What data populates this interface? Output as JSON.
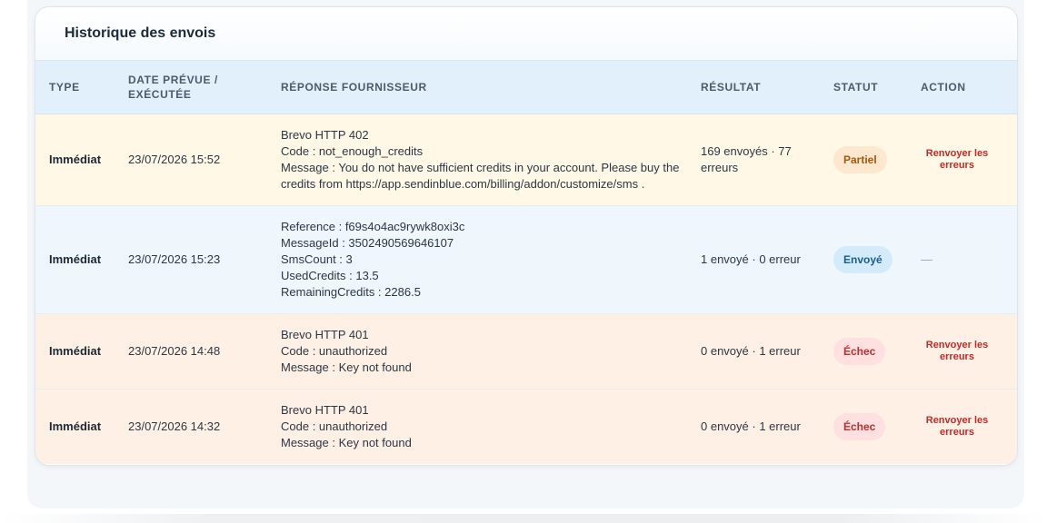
{
  "panel": {
    "title": "Historique des envois"
  },
  "table": {
    "headers": {
      "type": "TYPE",
      "date": "DATE PRÉVUE / EXÉCUTÉE",
      "response": "RÉPONSE FOURNISSEUR",
      "result": "RÉSULTAT",
      "status": "STATUT",
      "action": "ACTION"
    },
    "rows": [
      {
        "type": "Immédiat",
        "date": "23/07/2026 15:52",
        "response": [
          "Brevo HTTP 402",
          "Code : not_enough_credits",
          "Message : You do not have sufficient credits in your account. Please buy the credits from https://app.sendinblue.com/billing/addon/customize/sms ."
        ],
        "result": "169 envoyés · 77 erreurs",
        "status": "Partiel",
        "action": "Renvoyer les erreurs"
      },
      {
        "type": "Immédiat",
        "date": "23/07/2026 15:23",
        "response": [
          "Reference : f69s4o4ac9rywk8oxi3c",
          "MessageId : 3502490569646107",
          "SmsCount : 3",
          "UsedCredits : 13.5",
          "RemainingCredits : 2286.5"
        ],
        "result": "1 envoyé · 0 erreur",
        "status": "Envoyé",
        "action": "—"
      },
      {
        "type": "Immédiat",
        "date": "23/07/2026 14:48",
        "response": [
          "Brevo HTTP 401",
          "Code : unauthorized",
          "Message : Key not found"
        ],
        "result": "0 envoyé · 1 erreur",
        "status": "Échec",
        "action": "Renvoyer les erreurs"
      },
      {
        "type": "Immédiat",
        "date": "23/07/2026 14:32",
        "response": [
          "Brevo HTTP 401",
          "Code : unauthorized",
          "Message : Key not found"
        ],
        "result": "0 envoyé · 1 erreur",
        "status": "Échec",
        "action": "Renvoyer les erreurs"
      }
    ]
  },
  "colors": {
    "partial_row": "#fff8e6",
    "sent_row": "#eff6fc",
    "failed_row": "#fff0e6",
    "action_red": "#c42a27"
  }
}
